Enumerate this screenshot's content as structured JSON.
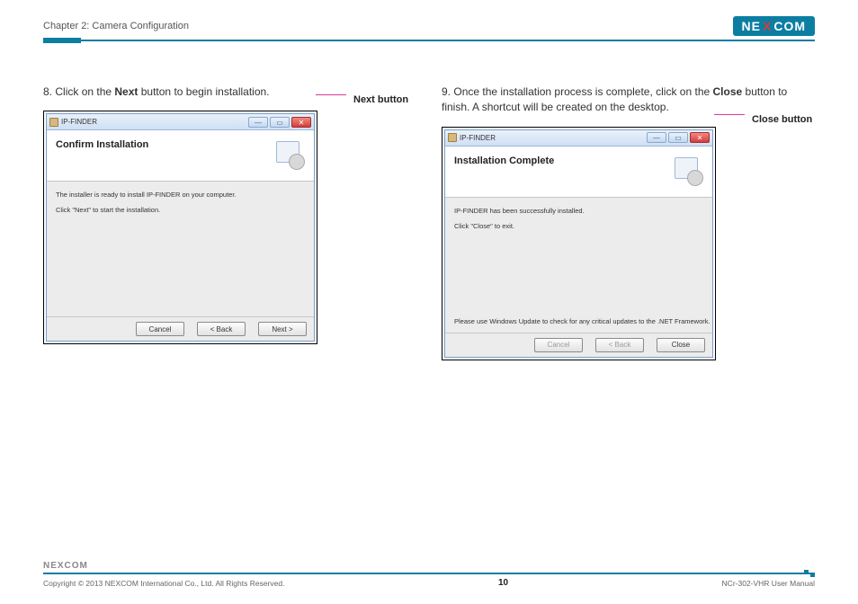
{
  "header": {
    "chapter": "Chapter 2: Camera Configuration",
    "logo_parts": {
      "ne": "NE",
      "x": "X",
      "com": "COM"
    }
  },
  "left": {
    "step_num": "8.",
    "step_text_a": "Click on the ",
    "step_bold": "Next",
    "step_text_b": " button to begin installation.",
    "callout": "Next button",
    "dialog": {
      "title": "IP-FINDER",
      "heading": "Confirm Installation",
      "body1": "The installer is ready to install IP-FINDER on your computer.",
      "body2": "Click \"Next\" to start the installation.",
      "btn_cancel": "Cancel",
      "btn_back": "< Back",
      "btn_next": "Next >"
    }
  },
  "right": {
    "step_num": "9.",
    "step_text_a": "Once the installation process is complete, click on the ",
    "step_bold": "Close",
    "step_text_b": " button to finish. A shortcut will be created on the desktop.",
    "callout": "Close button",
    "dialog": {
      "title": "IP-FINDER",
      "heading": "Installation Complete",
      "body1": "IP-FINDER has been successfully installed.",
      "body2": "Click \"Close\" to exit.",
      "footnote": "Please use Windows Update to check for any critical updates to the .NET Framework.",
      "btn_cancel": "Cancel",
      "btn_back": "< Back",
      "btn_close": "Close"
    }
  },
  "footer": {
    "logo": "NEXCOM",
    "copyright": "Copyright © 2013 NEXCOM International Co., Ltd. All Rights Reserved.",
    "page_num": "10",
    "doc": "NCr-302-VHR User Manual"
  }
}
